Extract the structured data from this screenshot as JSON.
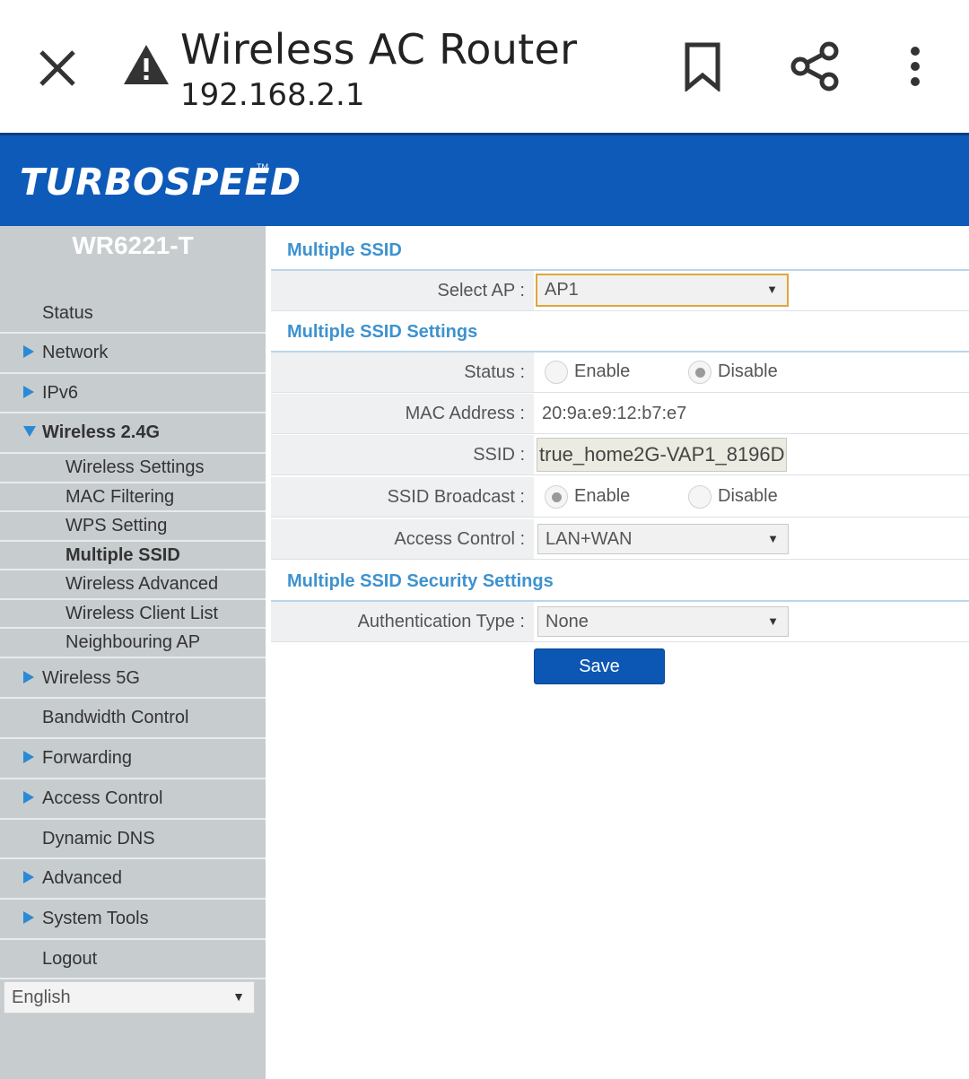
{
  "browser": {
    "title": "Wireless AC Router",
    "url": "192.168.2.1"
  },
  "brand": {
    "logo": "TURBOSPEED",
    "tm": "TM",
    "color": "#0d5ab9"
  },
  "sidebar": {
    "model": "WR6221-T",
    "items": [
      {
        "label": "Status"
      },
      {
        "label": "Network"
      },
      {
        "label": "IPv6"
      },
      {
        "label": "Wireless 2.4G"
      },
      {
        "label": "Wireless Settings"
      },
      {
        "label": "MAC Filtering"
      },
      {
        "label": "WPS Setting"
      },
      {
        "label": "Multiple SSID"
      },
      {
        "label": "Wireless Advanced"
      },
      {
        "label": "Wireless Client List"
      },
      {
        "label": "Neighbouring AP"
      },
      {
        "label": "Wireless 5G"
      },
      {
        "label": "Bandwidth Control"
      },
      {
        "label": "Forwarding"
      },
      {
        "label": "Access Control"
      },
      {
        "label": "Dynamic DNS"
      },
      {
        "label": "Advanced"
      },
      {
        "label": "System Tools"
      },
      {
        "label": "Logout"
      }
    ],
    "language": "English"
  },
  "main": {
    "section1_title": "Multiple SSID",
    "select_ap_label": "Select AP :",
    "select_ap_value": "AP1",
    "section2_title": "Multiple SSID Settings",
    "status_label": "Status :",
    "status_enable": "Enable",
    "status_disable": "Disable",
    "mac_label": "MAC Address :",
    "mac_value": "20:9a:e9:12:b7:e7",
    "ssid_label": "SSID :",
    "ssid_value": "true_home2G-VAP1_8196D",
    "broadcast_label": "SSID Broadcast :",
    "broadcast_enable": "Enable",
    "broadcast_disable": "Disable",
    "access_label": "Access Control :",
    "access_value": "LAN+WAN",
    "section3_title": "Multiple SSID Security Settings",
    "auth_label": "Authentication Type :",
    "auth_value": "None",
    "save_label": "Save",
    "accent_color": "#3d92cf"
  }
}
